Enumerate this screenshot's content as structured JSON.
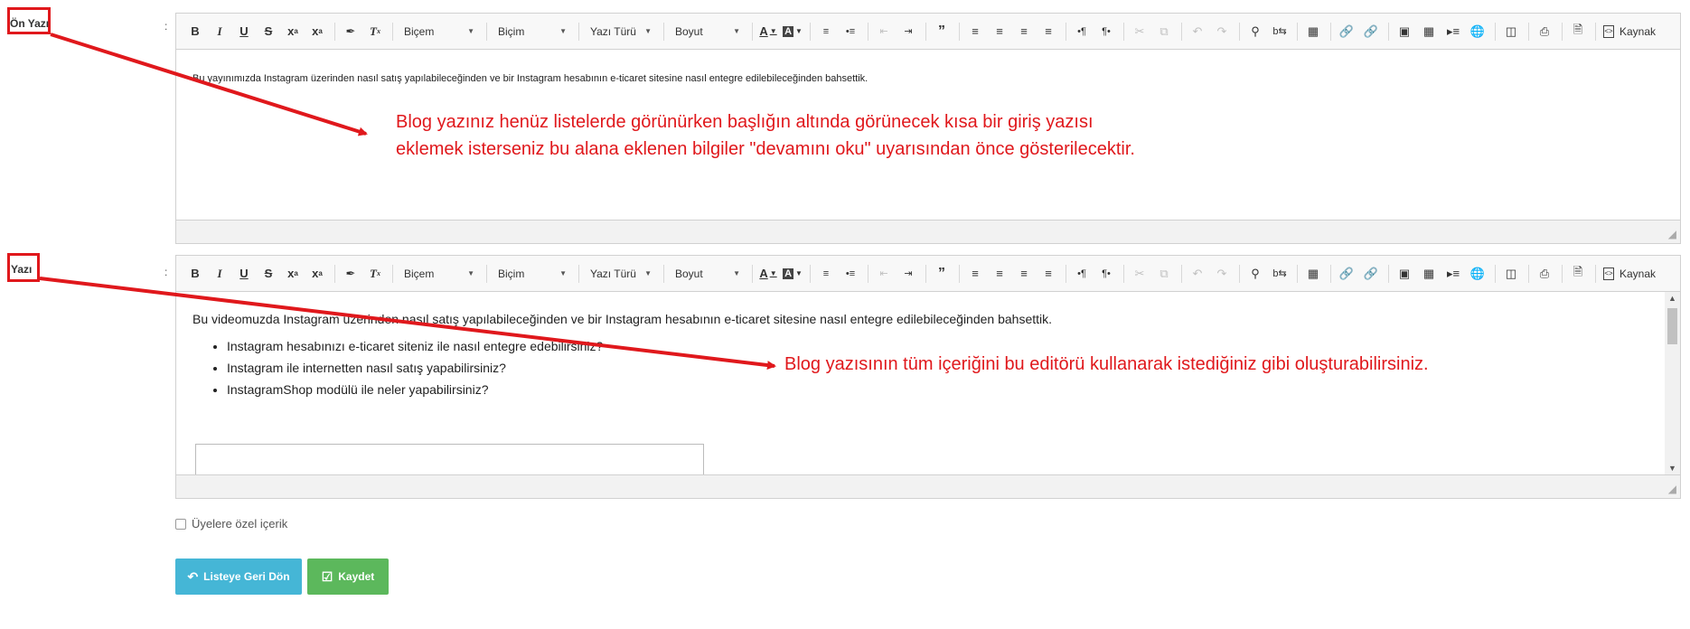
{
  "toolbar": {
    "style_label": "Biçem",
    "format_label": "Biçim",
    "font_label": "Yazı Türü",
    "size_label": "Boyut",
    "source_label": "Kaynak"
  },
  "intro_field": {
    "label": "Ön Yazı",
    "content": "Bu yayınımızda Instagram üzerinden nasıl satış yapılabileceğinden ve bir Instagram hesabının e-ticaret sitesine nasıl entegre edilebileceğinden bahsettik."
  },
  "body_field": {
    "label": "Yazı",
    "paragraph": "Bu videomuzda Instagram üzerinden nasıl satış yapılabileceğinden ve bir Instagram hesabının e-ticaret sitesine nasıl entegre edilebileceğinden bahsettik.",
    "list": [
      "Instagram hesabınızı e-ticaret siteniz ile nasıl entegre edebilirsiniz?",
      "Instagram ile internetten nasıl satış yapabilirsiniz?",
      "InstagramShop modülü ile neler yapabilirsiniz?"
    ]
  },
  "annotations": {
    "intro_line1": "Blog yazınız henüz listelerde görünürken başlığın altında görünecek kısa bir giriş yazısı",
    "intro_line2": "eklemek isterseniz bu alana eklenen bilgiler \"devamını oku\" uyarısından önce gösterilecektir.",
    "body": "Blog yazısının tüm içeriğini bu editörü kullanarak istediğiniz gibi oluşturabilirsiniz."
  },
  "members_only_label": "Üyelere özel içerik",
  "buttons": {
    "back_label": "Listeye Geri Dön",
    "save_label": "Kaydet"
  },
  "colors": {
    "annotation_red": "#e0181c",
    "back_button": "#45b6d6",
    "save_button": "#5cb85c"
  }
}
